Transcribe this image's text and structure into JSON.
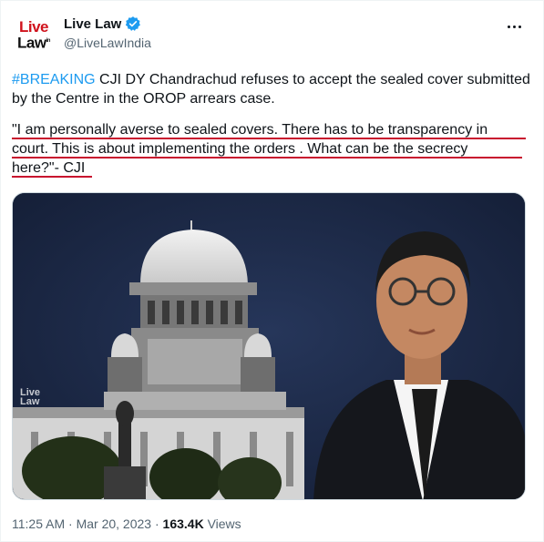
{
  "author": {
    "name": "Live Law",
    "handle": "@LiveLawIndia",
    "logo_top": "Live",
    "logo_bottom": "Law",
    "logo_sup": "in"
  },
  "tweet": {
    "hashtag": "#BREAKING",
    "headline": " CJI DY Chandrachud refuses to accept the sealed cover submitted by the Centre in the OROP arrears case.",
    "quote_line1": "\"I am personally averse to sealed covers. There has to be transparency in",
    "quote_line2": "court. This is about implementing the orders . What can be the secrecy",
    "quote_line3": "here?\"- CJI"
  },
  "media": {
    "watermark_top": "Live",
    "watermark_bottom": "Law",
    "background_color": "#1c2945"
  },
  "footer": {
    "time": "11:25 AM",
    "sep1": " · ",
    "date": "Mar 20, 2023",
    "sep2": " · ",
    "views_count": "163.4K",
    "views_label": " Views"
  },
  "icons": {
    "verified": "verified-badge-icon",
    "more": "more-options-icon"
  },
  "colors": {
    "hashtag": "#1d9bf0",
    "underline": "#c8102e",
    "muted": "#536471"
  }
}
